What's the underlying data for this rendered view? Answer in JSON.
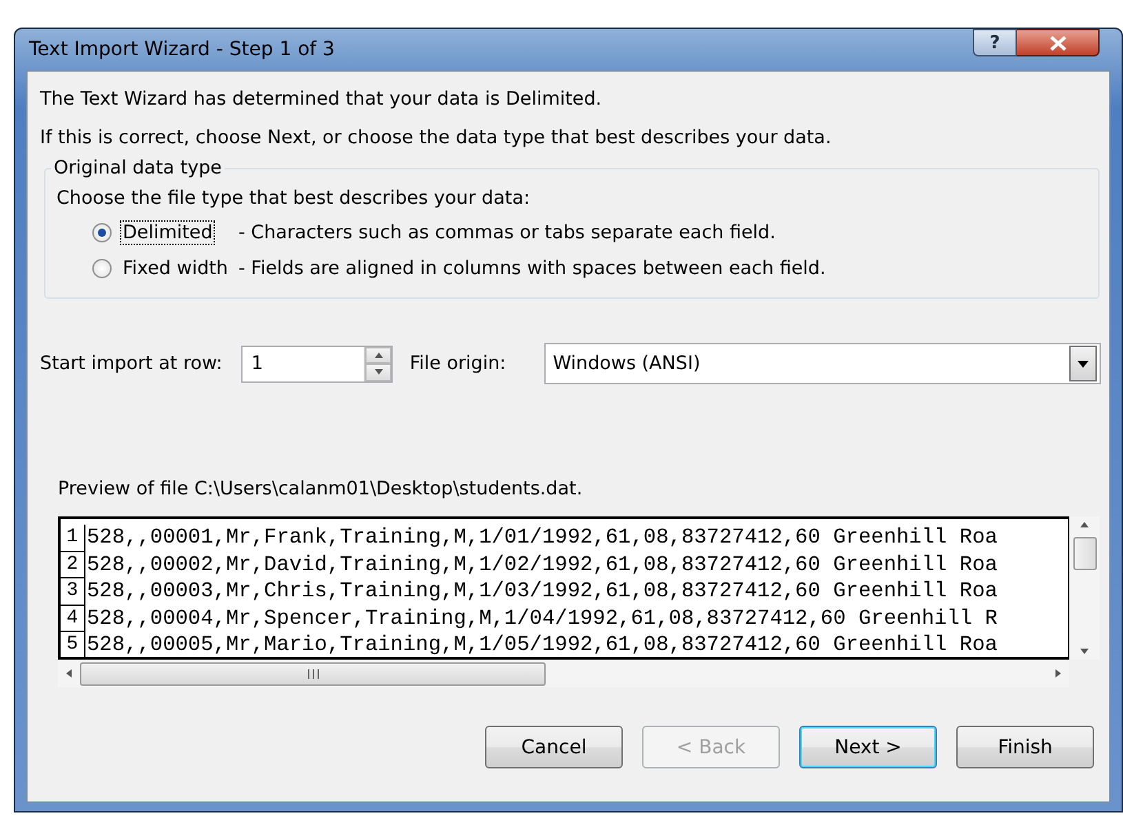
{
  "window": {
    "title": "Text Import Wizard - Step 1 of 3",
    "help_glyph": "?"
  },
  "intro": [
    "The Text Wizard has determined that your data is Delimited.",
    "If this is correct, choose Next, or choose the data type that best describes your data."
  ],
  "data_type_group": {
    "legend": "Original data type",
    "prompt": "Choose the file type that best describes your data:",
    "options": [
      {
        "label": "Delimited",
        "description": "- Characters such as commas or tabs separate each field.",
        "selected": true,
        "focused": true
      },
      {
        "label": "Fixed width",
        "description": "- Fields are aligned in columns with spaces between each field.",
        "selected": false,
        "focused": false
      }
    ]
  },
  "start_row": {
    "label": "Start import at row:",
    "value": "1"
  },
  "file_origin": {
    "label": "File origin:",
    "value": "Windows (ANSI)"
  },
  "preview": {
    "label": "Preview of file C:\\Users\\calanm01\\Desktop\\students.dat.",
    "rows": [
      {
        "number": "1",
        "text": "528,,00001,Mr,Frank,Training,M,1/01/1992,61,08,83727412,60 Greenhill Roa"
      },
      {
        "number": "2",
        "text": "528,,00002,Mr,David,Training,M,1/02/1992,61,08,83727412,60 Greenhill Roa"
      },
      {
        "number": "3",
        "text": "528,,00003,Mr,Chris,Training,M,1/03/1992,61,08,83727412,60 Greenhill Roa"
      },
      {
        "number": "4",
        "text": "528,,00004,Mr,Spencer,Training,M,1/04/1992,61,08,83727412,60 Greenhill R"
      },
      {
        "number": "5",
        "text": "528,,00005,Mr,Mario,Training,M,1/05/1992,61,08,83727412,60 Greenhill Roa"
      }
    ]
  },
  "buttons": [
    {
      "label": "Cancel",
      "disabled": false,
      "default": false
    },
    {
      "label": "< Back",
      "disabled": true,
      "default": false
    },
    {
      "label": "Next >",
      "disabled": false,
      "default": true
    },
    {
      "label": "Finish",
      "disabled": false,
      "default": false
    }
  ]
}
